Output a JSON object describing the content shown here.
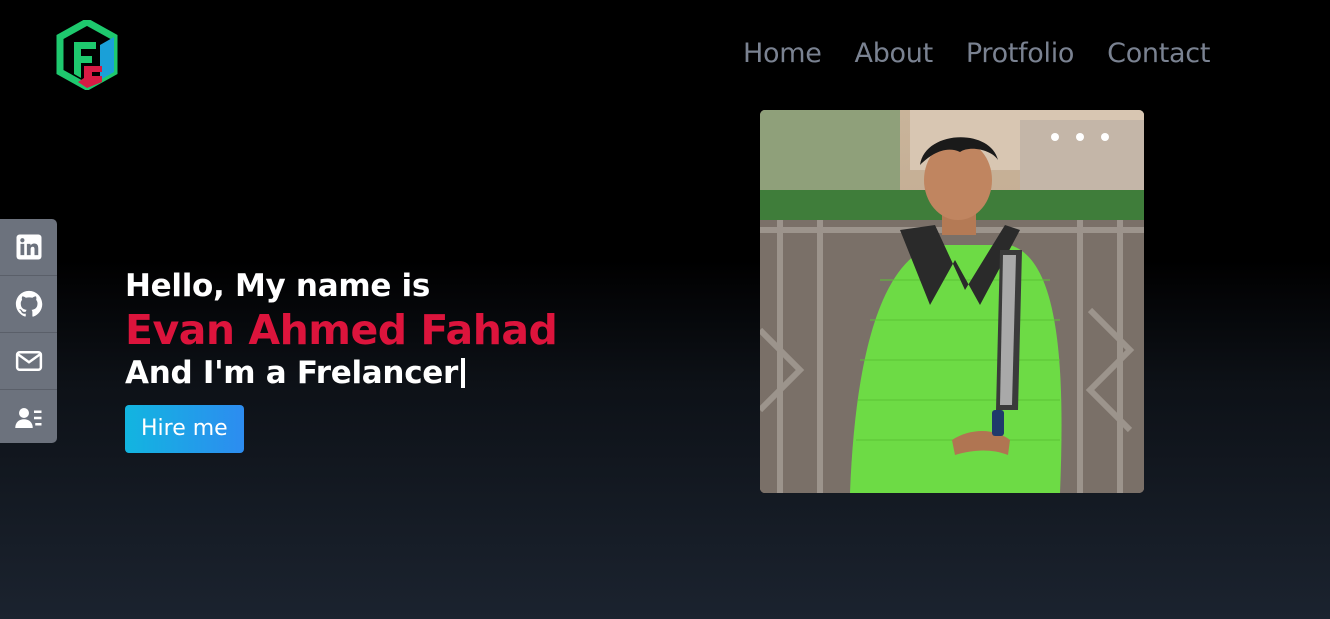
{
  "logo": {
    "icon": "fe-logo-icon"
  },
  "nav": {
    "items": [
      {
        "label": "Home"
      },
      {
        "label": "About"
      },
      {
        "label": "Protfolio"
      },
      {
        "label": "Contact"
      }
    ]
  },
  "social": {
    "items": [
      {
        "icon": "linkedin-icon"
      },
      {
        "icon": "github-icon"
      },
      {
        "icon": "mail-icon"
      },
      {
        "icon": "contact-card-icon"
      }
    ]
  },
  "hero": {
    "greeting": "Hello, My name is",
    "name": "Evan Ahmed Fahad",
    "role": "And I'm a Frelancer",
    "button": "Hire me"
  },
  "colors": {
    "name": "#dc143c",
    "nav": "#7a8291",
    "button_start": "#12b5e0",
    "button_end": "#2d8cf0",
    "sidebar": "#6c727d"
  }
}
